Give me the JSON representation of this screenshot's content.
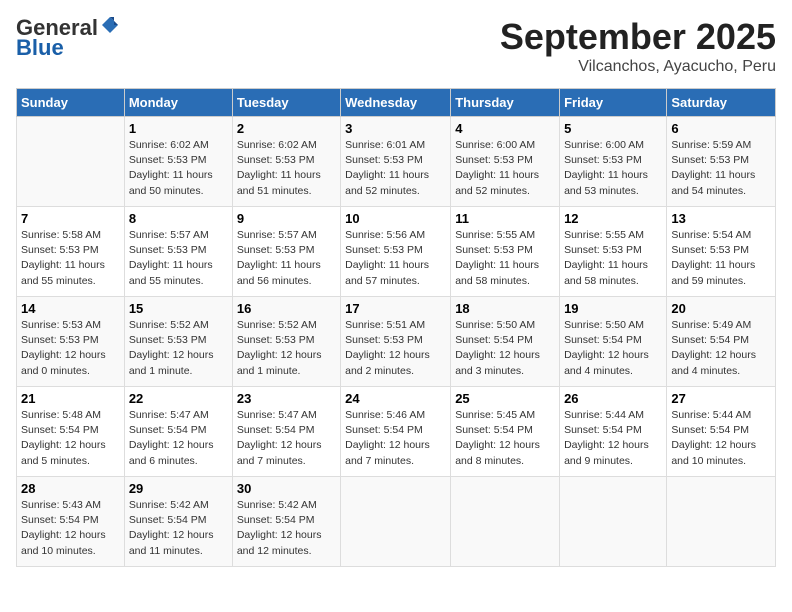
{
  "header": {
    "logo_general": "General",
    "logo_blue": "Blue",
    "month_title": "September 2025",
    "subtitle": "Vilcanchos, Ayacucho, Peru"
  },
  "days_of_week": [
    "Sunday",
    "Monday",
    "Tuesday",
    "Wednesday",
    "Thursday",
    "Friday",
    "Saturday"
  ],
  "weeks": [
    [
      {
        "day": "",
        "sunrise": "",
        "sunset": "",
        "daylight": ""
      },
      {
        "day": "1",
        "sunrise": "Sunrise: 6:02 AM",
        "sunset": "Sunset: 5:53 PM",
        "daylight": "Daylight: 11 hours and 50 minutes."
      },
      {
        "day": "2",
        "sunrise": "Sunrise: 6:02 AM",
        "sunset": "Sunset: 5:53 PM",
        "daylight": "Daylight: 11 hours and 51 minutes."
      },
      {
        "day": "3",
        "sunrise": "Sunrise: 6:01 AM",
        "sunset": "Sunset: 5:53 PM",
        "daylight": "Daylight: 11 hours and 52 minutes."
      },
      {
        "day": "4",
        "sunrise": "Sunrise: 6:00 AM",
        "sunset": "Sunset: 5:53 PM",
        "daylight": "Daylight: 11 hours and 52 minutes."
      },
      {
        "day": "5",
        "sunrise": "Sunrise: 6:00 AM",
        "sunset": "Sunset: 5:53 PM",
        "daylight": "Daylight: 11 hours and 53 minutes."
      },
      {
        "day": "6",
        "sunrise": "Sunrise: 5:59 AM",
        "sunset": "Sunset: 5:53 PM",
        "daylight": "Daylight: 11 hours and 54 minutes."
      }
    ],
    [
      {
        "day": "7",
        "sunrise": "Sunrise: 5:58 AM",
        "sunset": "Sunset: 5:53 PM",
        "daylight": "Daylight: 11 hours and 55 minutes."
      },
      {
        "day": "8",
        "sunrise": "Sunrise: 5:57 AM",
        "sunset": "Sunset: 5:53 PM",
        "daylight": "Daylight: 11 hours and 55 minutes."
      },
      {
        "day": "9",
        "sunrise": "Sunrise: 5:57 AM",
        "sunset": "Sunset: 5:53 PM",
        "daylight": "Daylight: 11 hours and 56 minutes."
      },
      {
        "day": "10",
        "sunrise": "Sunrise: 5:56 AM",
        "sunset": "Sunset: 5:53 PM",
        "daylight": "Daylight: 11 hours and 57 minutes."
      },
      {
        "day": "11",
        "sunrise": "Sunrise: 5:55 AM",
        "sunset": "Sunset: 5:53 PM",
        "daylight": "Daylight: 11 hours and 58 minutes."
      },
      {
        "day": "12",
        "sunrise": "Sunrise: 5:55 AM",
        "sunset": "Sunset: 5:53 PM",
        "daylight": "Daylight: 11 hours and 58 minutes."
      },
      {
        "day": "13",
        "sunrise": "Sunrise: 5:54 AM",
        "sunset": "Sunset: 5:53 PM",
        "daylight": "Daylight: 11 hours and 59 minutes."
      }
    ],
    [
      {
        "day": "14",
        "sunrise": "Sunrise: 5:53 AM",
        "sunset": "Sunset: 5:53 PM",
        "daylight": "Daylight: 12 hours and 0 minutes."
      },
      {
        "day": "15",
        "sunrise": "Sunrise: 5:52 AM",
        "sunset": "Sunset: 5:53 PM",
        "daylight": "Daylight: 12 hours and 1 minute."
      },
      {
        "day": "16",
        "sunrise": "Sunrise: 5:52 AM",
        "sunset": "Sunset: 5:53 PM",
        "daylight": "Daylight: 12 hours and 1 minute."
      },
      {
        "day": "17",
        "sunrise": "Sunrise: 5:51 AM",
        "sunset": "Sunset: 5:53 PM",
        "daylight": "Daylight: 12 hours and 2 minutes."
      },
      {
        "day": "18",
        "sunrise": "Sunrise: 5:50 AM",
        "sunset": "Sunset: 5:54 PM",
        "daylight": "Daylight: 12 hours and 3 minutes."
      },
      {
        "day": "19",
        "sunrise": "Sunrise: 5:50 AM",
        "sunset": "Sunset: 5:54 PM",
        "daylight": "Daylight: 12 hours and 4 minutes."
      },
      {
        "day": "20",
        "sunrise": "Sunrise: 5:49 AM",
        "sunset": "Sunset: 5:54 PM",
        "daylight": "Daylight: 12 hours and 4 minutes."
      }
    ],
    [
      {
        "day": "21",
        "sunrise": "Sunrise: 5:48 AM",
        "sunset": "Sunset: 5:54 PM",
        "daylight": "Daylight: 12 hours and 5 minutes."
      },
      {
        "day": "22",
        "sunrise": "Sunrise: 5:47 AM",
        "sunset": "Sunset: 5:54 PM",
        "daylight": "Daylight: 12 hours and 6 minutes."
      },
      {
        "day": "23",
        "sunrise": "Sunrise: 5:47 AM",
        "sunset": "Sunset: 5:54 PM",
        "daylight": "Daylight: 12 hours and 7 minutes."
      },
      {
        "day": "24",
        "sunrise": "Sunrise: 5:46 AM",
        "sunset": "Sunset: 5:54 PM",
        "daylight": "Daylight: 12 hours and 7 minutes."
      },
      {
        "day": "25",
        "sunrise": "Sunrise: 5:45 AM",
        "sunset": "Sunset: 5:54 PM",
        "daylight": "Daylight: 12 hours and 8 minutes."
      },
      {
        "day": "26",
        "sunrise": "Sunrise: 5:44 AM",
        "sunset": "Sunset: 5:54 PM",
        "daylight": "Daylight: 12 hours and 9 minutes."
      },
      {
        "day": "27",
        "sunrise": "Sunrise: 5:44 AM",
        "sunset": "Sunset: 5:54 PM",
        "daylight": "Daylight: 12 hours and 10 minutes."
      }
    ],
    [
      {
        "day": "28",
        "sunrise": "Sunrise: 5:43 AM",
        "sunset": "Sunset: 5:54 PM",
        "daylight": "Daylight: 12 hours and 10 minutes."
      },
      {
        "day": "29",
        "sunrise": "Sunrise: 5:42 AM",
        "sunset": "Sunset: 5:54 PM",
        "daylight": "Daylight: 12 hours and 11 minutes."
      },
      {
        "day": "30",
        "sunrise": "Sunrise: 5:42 AM",
        "sunset": "Sunset: 5:54 PM",
        "daylight": "Daylight: 12 hours and 12 minutes."
      },
      {
        "day": "",
        "sunrise": "",
        "sunset": "",
        "daylight": ""
      },
      {
        "day": "",
        "sunrise": "",
        "sunset": "",
        "daylight": ""
      },
      {
        "day": "",
        "sunrise": "",
        "sunset": "",
        "daylight": ""
      },
      {
        "day": "",
        "sunrise": "",
        "sunset": "",
        "daylight": ""
      }
    ]
  ]
}
